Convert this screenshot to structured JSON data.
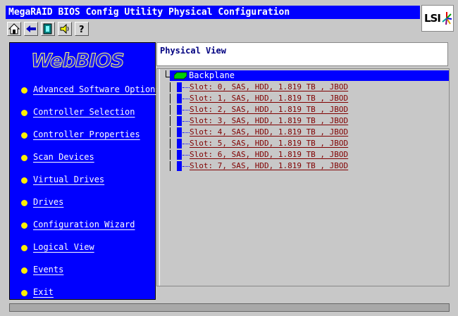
{
  "window": {
    "title": "MegaRAID BIOS Config Utility Physical Configuration"
  },
  "brand": {
    "logo_text": "LSI"
  },
  "toolbar": {
    "buttons": [
      {
        "icon": "home-icon"
      },
      {
        "icon": "back-arrow-icon"
      },
      {
        "icon": "exit-icon"
      },
      {
        "icon": "speaker-icon"
      },
      {
        "icon": "help-icon"
      }
    ]
  },
  "sidebar": {
    "logo": "WebBIOS",
    "items": [
      {
        "label": "Advanced Software Options"
      },
      {
        "label": "Controller Selection"
      },
      {
        "label": "Controller Properties"
      },
      {
        "label": "Scan Devices"
      },
      {
        "label": "Virtual Drives"
      },
      {
        "label": "Drives"
      },
      {
        "label": "Configuration Wizard"
      },
      {
        "label": "Logical View"
      },
      {
        "label": "Events"
      },
      {
        "label": "Exit"
      }
    ]
  },
  "main": {
    "view_title": "Physical View",
    "tree": {
      "root": "Backplane",
      "slots": [
        "Slot: 0, SAS, HDD, 1.819 TB , JBOD",
        "Slot: 1, SAS, HDD, 1.819 TB , JBOD",
        "Slot: 2, SAS, HDD, 1.819 TB , JBOD",
        "Slot: 3, SAS, HDD, 1.819 TB , JBOD",
        "Slot: 4, SAS, HDD, 1.819 TB , JBOD",
        "Slot: 5, SAS, HDD, 1.819 TB , JBOD",
        "Slot: 6, SAS, HDD, 1.819 TB , JBOD",
        "Slot: 7, SAS, HDD, 1.819 TB , JBOD"
      ]
    }
  },
  "colors": {
    "accent": "#0000ff",
    "nav_bullet": "#ffee00",
    "slot_text": "#800000"
  }
}
